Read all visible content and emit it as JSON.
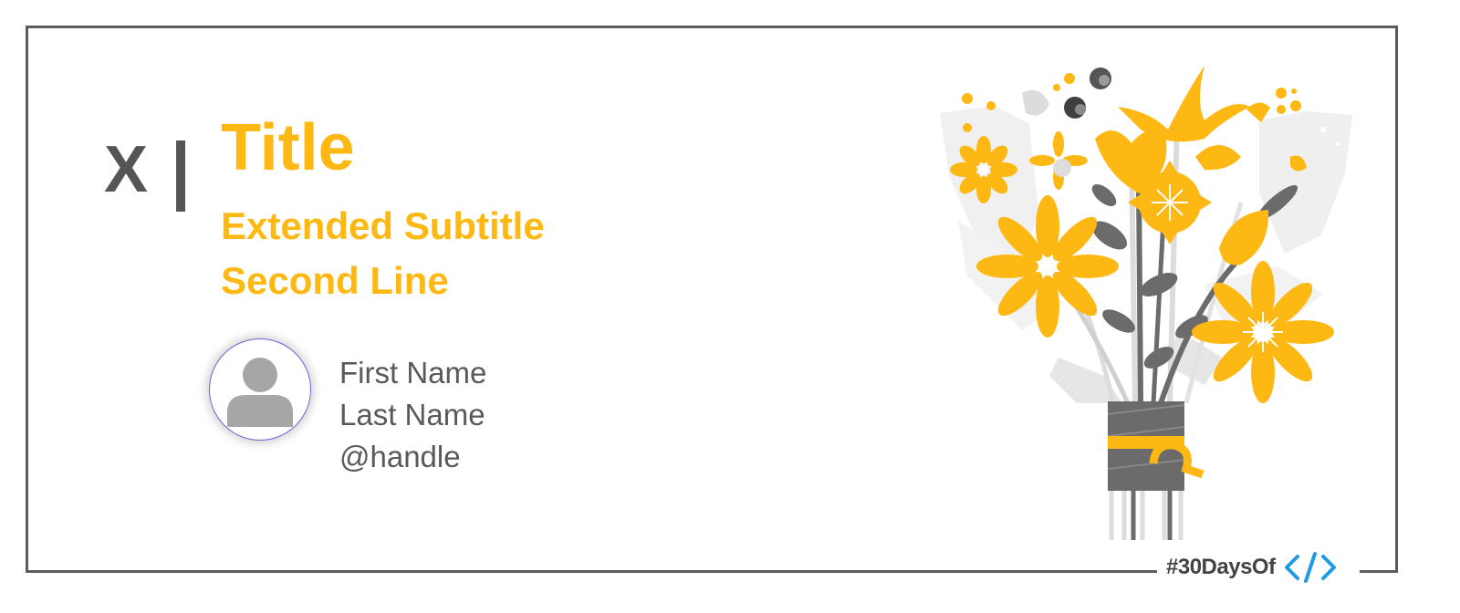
{
  "card": {
    "series_prefix": "X",
    "title": "Title",
    "subtitle_lines": [
      "Extended Subtitle",
      "Second Line"
    ],
    "author": {
      "first_name": "First Name",
      "last_name": "Last Name",
      "handle": "@handle"
    },
    "brand": {
      "text": "#30DaysOf",
      "icon": "code-brackets-icon"
    },
    "illustration": "flower-bouquet-illustration",
    "avatar_icon": "user-silhouette-icon"
  },
  "colors": {
    "accent": "#FDB813",
    "text_gray": "#595959",
    "frame_gray": "#5c5c5c",
    "brand_blue": "#1E9BE3"
  }
}
